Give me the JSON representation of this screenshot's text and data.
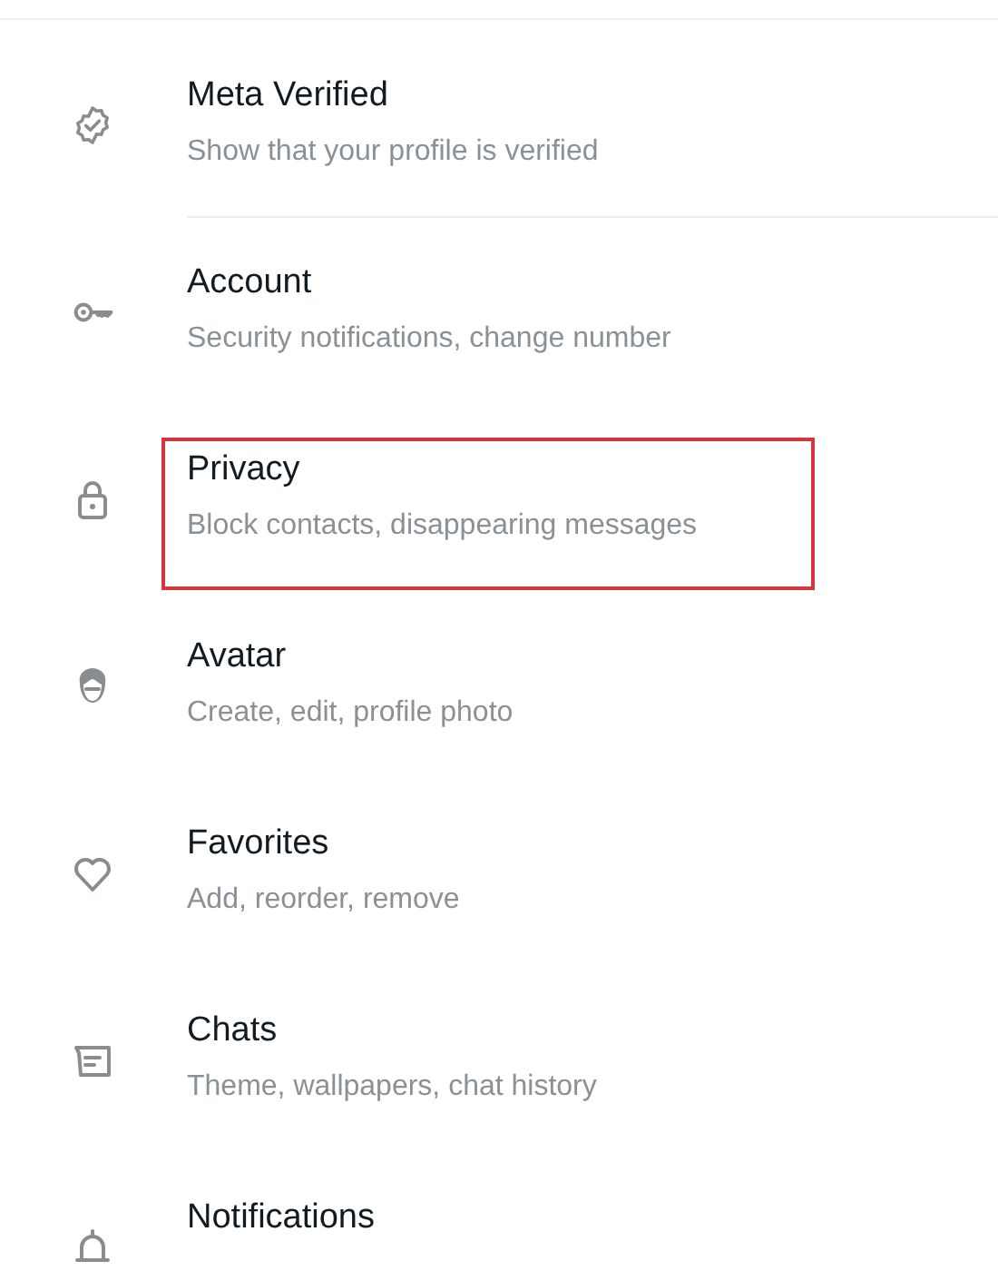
{
  "items": [
    {
      "title": "Meta Verified",
      "subtitle": "Show that your profile is verified",
      "divider_below": true,
      "highlighted": false
    },
    {
      "title": "Account",
      "subtitle": "Security notifications, change number",
      "divider_below": false,
      "highlighted": false
    },
    {
      "title": "Privacy",
      "subtitle": "Block contacts, disappearing messages",
      "divider_below": false,
      "highlighted": true
    },
    {
      "title": "Avatar",
      "subtitle": "Create, edit, profile photo",
      "divider_below": false,
      "highlighted": false
    },
    {
      "title": "Favorites",
      "subtitle": "Add, reorder, remove",
      "divider_below": false,
      "highlighted": false
    },
    {
      "title": "Chats",
      "subtitle": "Theme, wallpapers, chat history",
      "divider_below": false,
      "highlighted": false
    },
    {
      "title": "Notifications",
      "divider_below": false,
      "highlighted": false
    }
  ]
}
